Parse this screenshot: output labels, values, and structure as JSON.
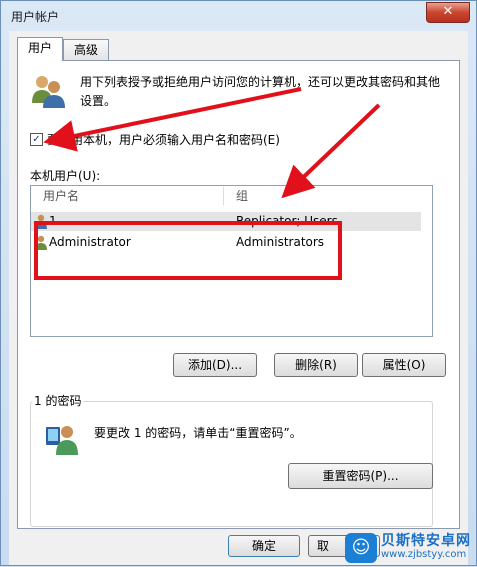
{
  "window": {
    "title": "用户帐户",
    "close_glyph": "✕"
  },
  "tabs": [
    {
      "label": "用户"
    },
    {
      "label": "高级"
    }
  ],
  "intro": {
    "text": "用下列表授予或拒绝用户访问您的计算机，还可以更改其密码和其他设置。",
    "icon": "users-icon"
  },
  "require_login": {
    "label": "要使用本机，用户必须输入用户名和密码(E)",
    "checked": true
  },
  "users_list": {
    "label": "本机用户(U):",
    "columns": [
      "用户名",
      "组"
    ],
    "rows": [
      {
        "name": "1",
        "group": "Replicator; Users",
        "selected": true
      },
      {
        "name": "Administrator",
        "group": "Administrators",
        "selected": false
      }
    ]
  },
  "list_buttons": {
    "add": "添加(D)...",
    "remove": "删除(R)",
    "properties": "属性(O)"
  },
  "password_group": {
    "title": "1 的密码",
    "text": "要更改 1 的密码，请单击“重置密码”。",
    "reset_button": "重置密码(P)..."
  },
  "dialog_buttons": {
    "ok": "确定",
    "cancel": "取"
  },
  "watermark": {
    "name": "贝斯特安卓网",
    "url": "www.zjbstyy.com"
  },
  "colors": {
    "highlight": "#e0111a",
    "accent": "#1b7fd6"
  }
}
